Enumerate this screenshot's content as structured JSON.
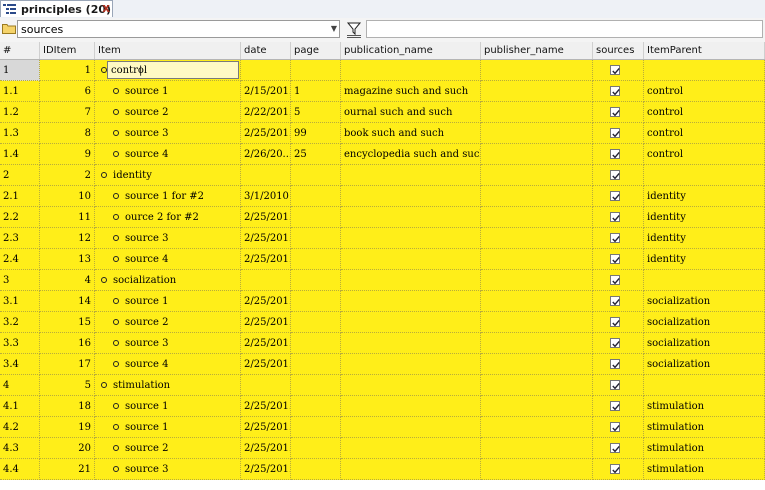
{
  "tab": {
    "title": "principles (20)",
    "close_label": "x"
  },
  "toolbar": {
    "selected_table": "sources"
  },
  "columns": [
    "#",
    "IDItem",
    "Item",
    "date",
    "page",
    "publication_name",
    "publisher_name",
    "sources",
    "ItemParent"
  ],
  "rows": [
    {
      "num": "1",
      "id": "1",
      "item": "control",
      "date": "",
      "page": "",
      "pub": "",
      "publisher": "",
      "checked": true,
      "parent": "",
      "level": 0,
      "editing": true,
      "caret": "|"
    },
    {
      "num": "1.1",
      "id": "6",
      "item": "source 1",
      "date": "2/15/201...",
      "page": "1",
      "pub": "magazine such and such",
      "publisher": "",
      "checked": true,
      "parent": "control",
      "level": 1
    },
    {
      "num": "1.2",
      "id": "7",
      "item": "source 2",
      "date": "2/22/201...",
      "page": "5",
      "pub": "ournal such and such",
      "publisher": "",
      "checked": true,
      "parent": "control",
      "level": 1
    },
    {
      "num": "1.3",
      "id": "8",
      "item": "source 3",
      "date": "2/25/201...",
      "page": "99",
      "pub": "book such and such",
      "publisher": "",
      "checked": true,
      "parent": "control",
      "level": 1
    },
    {
      "num": "1.4",
      "id": "9",
      "item": "source 4",
      "date": "2/26/20...",
      "page": "25",
      "pub": "encyclopedia such and such",
      "publisher": "",
      "checked": true,
      "parent": "control",
      "level": 1
    },
    {
      "num": "2",
      "id": "2",
      "item": "identity",
      "date": "",
      "page": "",
      "pub": "",
      "publisher": "",
      "checked": true,
      "parent": "",
      "level": 0
    },
    {
      "num": "2.1",
      "id": "10",
      "item": "source 1 for #2",
      "date": "3/1/2010",
      "page": "",
      "pub": "",
      "publisher": "",
      "checked": true,
      "parent": "identity",
      "level": 1
    },
    {
      "num": "2.2",
      "id": "11",
      "item": "ource 2 for #2",
      "date": "2/25/201...",
      "page": "",
      "pub": "",
      "publisher": "",
      "checked": true,
      "parent": "identity",
      "level": 1
    },
    {
      "num": "2.3",
      "id": "12",
      "item": "source 3",
      "date": "2/25/201...",
      "page": "",
      "pub": "",
      "publisher": "",
      "checked": true,
      "parent": "identity",
      "level": 1
    },
    {
      "num": "2.4",
      "id": "13",
      "item": "source 4",
      "date": "2/25/201...",
      "page": "",
      "pub": "",
      "publisher": "",
      "checked": true,
      "parent": "identity",
      "level": 1
    },
    {
      "num": "3",
      "id": "4",
      "item": "socialization",
      "date": "",
      "page": "",
      "pub": "",
      "publisher": "",
      "checked": true,
      "parent": "",
      "level": 0
    },
    {
      "num": "3.1",
      "id": "14",
      "item": "source 1",
      "date": "2/25/201...",
      "page": "",
      "pub": "",
      "publisher": "",
      "checked": true,
      "parent": "socialization",
      "level": 1
    },
    {
      "num": "3.2",
      "id": "15",
      "item": "source 2",
      "date": "2/25/201...",
      "page": "",
      "pub": "",
      "publisher": "",
      "checked": true,
      "parent": "socialization",
      "level": 1
    },
    {
      "num": "3.3",
      "id": "16",
      "item": "source 3",
      "date": "2/25/201...",
      "page": "",
      "pub": "",
      "publisher": "",
      "checked": true,
      "parent": "socialization",
      "level": 1
    },
    {
      "num": "3.4",
      "id": "17",
      "item": "source 4",
      "date": "2/25/201...",
      "page": "",
      "pub": "",
      "publisher": "",
      "checked": true,
      "parent": "socialization",
      "level": 1
    },
    {
      "num": "4",
      "id": "5",
      "item": "stimulation",
      "date": "",
      "page": "",
      "pub": "",
      "publisher": "",
      "checked": true,
      "parent": "",
      "level": 0
    },
    {
      "num": "4.1",
      "id": "18",
      "item": "source 1",
      "date": "2/25/201...",
      "page": "",
      "pub": "",
      "publisher": "",
      "checked": true,
      "parent": "stimulation",
      "level": 1
    },
    {
      "num": "4.2",
      "id": "19",
      "item": "source 1",
      "date": "2/25/201...",
      "page": "",
      "pub": "",
      "publisher": "",
      "checked": true,
      "parent": "stimulation",
      "level": 1
    },
    {
      "num": "4.3",
      "id": "20",
      "item": "source 2",
      "date": "2/25/201...",
      "page": "",
      "pub": "",
      "publisher": "",
      "checked": true,
      "parent": "stimulation",
      "level": 1
    },
    {
      "num": "4.4",
      "id": "21",
      "item": "source 3",
      "date": "2/25/201...",
      "page": "",
      "pub": "",
      "publisher": "",
      "checked": true,
      "parent": "stimulation",
      "level": 1
    }
  ],
  "icons": {
    "tab": "tree-list-icon",
    "folder": "folder-icon",
    "dropdown": "chevron-down-icon",
    "filter": "filter-icon",
    "checkbox": "checkmark-icon"
  },
  "colors": {
    "row_bg": "#ffee19",
    "header_bg": "#f0f0f0",
    "selected_num_bg": "#d8d8d8"
  }
}
